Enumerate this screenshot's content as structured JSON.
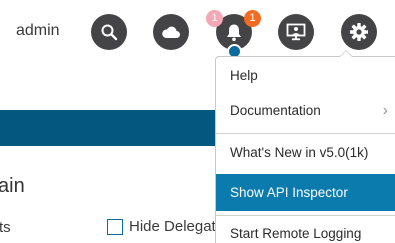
{
  "header": {
    "username": "admin",
    "buttons": [
      {
        "name": "search",
        "icon": "search-icon"
      },
      {
        "name": "cloud",
        "icon": "cloud-icon"
      },
      {
        "name": "alerts",
        "icon": "bell-icon"
      },
      {
        "name": "screen",
        "icon": "monitor-icon"
      },
      {
        "name": "settings",
        "icon": "gear-icon"
      }
    ],
    "badges": {
      "pink": "1",
      "orange": "1"
    }
  },
  "page": {
    "heading_fragment": "ain",
    "filter_fragment": "ts",
    "hide_delegated_label": "Hide Delegat"
  },
  "menu": {
    "items": [
      {
        "label": "Help",
        "chevron": ""
      },
      {
        "label": "Documentation",
        "chevron": "›"
      },
      {
        "label": "What's New in v5.0(1k)",
        "chevron": ""
      },
      {
        "label": "Show API Inspector",
        "chevron": ""
      },
      {
        "label": "Start Remote Logging",
        "chevron": ""
      }
    ],
    "active_index": 3
  },
  "colors": {
    "header_button_bg": "#444446",
    "band": "#04577f",
    "menu_active": "#0b7bae",
    "badge_orange": "#f26b21",
    "badge_pink": "#f4a7b5",
    "badge_blue": "#0b6c9c"
  }
}
